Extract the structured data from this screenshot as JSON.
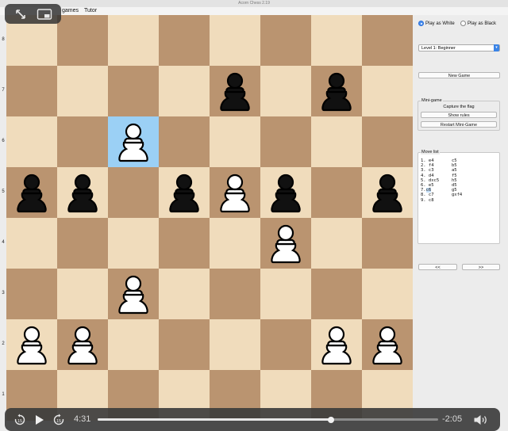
{
  "window": {
    "title": "Acorn Chess 2.19"
  },
  "menu": {
    "items": [
      "games",
      "Tutor"
    ]
  },
  "board": {
    "ranks": [
      "8",
      "7",
      "6",
      "5",
      "4",
      "3",
      "2",
      "1"
    ],
    "highlight": "c6",
    "pieces": [
      {
        "sq": "e7",
        "color": "black",
        "type": "pawn"
      },
      {
        "sq": "g7",
        "color": "black",
        "type": "pawn"
      },
      {
        "sq": "c6",
        "color": "white",
        "type": "pawn"
      },
      {
        "sq": "a5",
        "color": "black",
        "type": "pawn"
      },
      {
        "sq": "b5",
        "color": "black",
        "type": "pawn"
      },
      {
        "sq": "d5",
        "color": "black",
        "type": "pawn"
      },
      {
        "sq": "e5",
        "color": "white",
        "type": "pawn"
      },
      {
        "sq": "f5",
        "color": "black",
        "type": "pawn"
      },
      {
        "sq": "h5",
        "color": "black",
        "type": "pawn"
      },
      {
        "sq": "f4",
        "color": "white",
        "type": "pawn"
      },
      {
        "sq": "c3",
        "color": "white",
        "type": "pawn"
      },
      {
        "sq": "a2",
        "color": "white",
        "type": "pawn"
      },
      {
        "sq": "b2",
        "color": "white",
        "type": "pawn"
      },
      {
        "sq": "g2",
        "color": "white",
        "type": "pawn"
      },
      {
        "sq": "h2",
        "color": "white",
        "type": "pawn"
      }
    ],
    "colors": {
      "light": "#f0dcbc",
      "dark": "#ba9470",
      "highlight": "#9bd0f5"
    }
  },
  "panel": {
    "play_white": "Play as White",
    "play_black": "Play as Black",
    "selected_side": "white",
    "level": "Level 1: Beginner",
    "new_game": "New Game",
    "minigame": {
      "title": "Mini-game",
      "caption": "Capture the flag",
      "show_rules": "Show rules",
      "restart": "Restart Mini-Game"
    },
    "movelist": {
      "title": "Move list",
      "moves": [
        {
          "white": "1.  e4",
          "black": "c5"
        },
        {
          "white": "2.  f4",
          "black": "b5"
        },
        {
          "white": "3.  c3",
          "black": "a5"
        },
        {
          "white": "4.  d4",
          "black": "f5"
        },
        {
          "white": "5.  dxc5",
          "black": "h5"
        },
        {
          "white": "6.  e5",
          "black": "d5"
        },
        {
          "white": "7.  c6",
          "black": "g5"
        },
        {
          "white": "8.  c7",
          "black": "gxf4"
        },
        {
          "white": "9.  c8",
          "black": ""
        }
      ]
    },
    "prev_label": "<<",
    "next_label": ">>"
  },
  "player": {
    "elapsed": "4:31",
    "remaining": "-2:05",
    "progress": 0.685,
    "accent": "#e6e6e6"
  }
}
